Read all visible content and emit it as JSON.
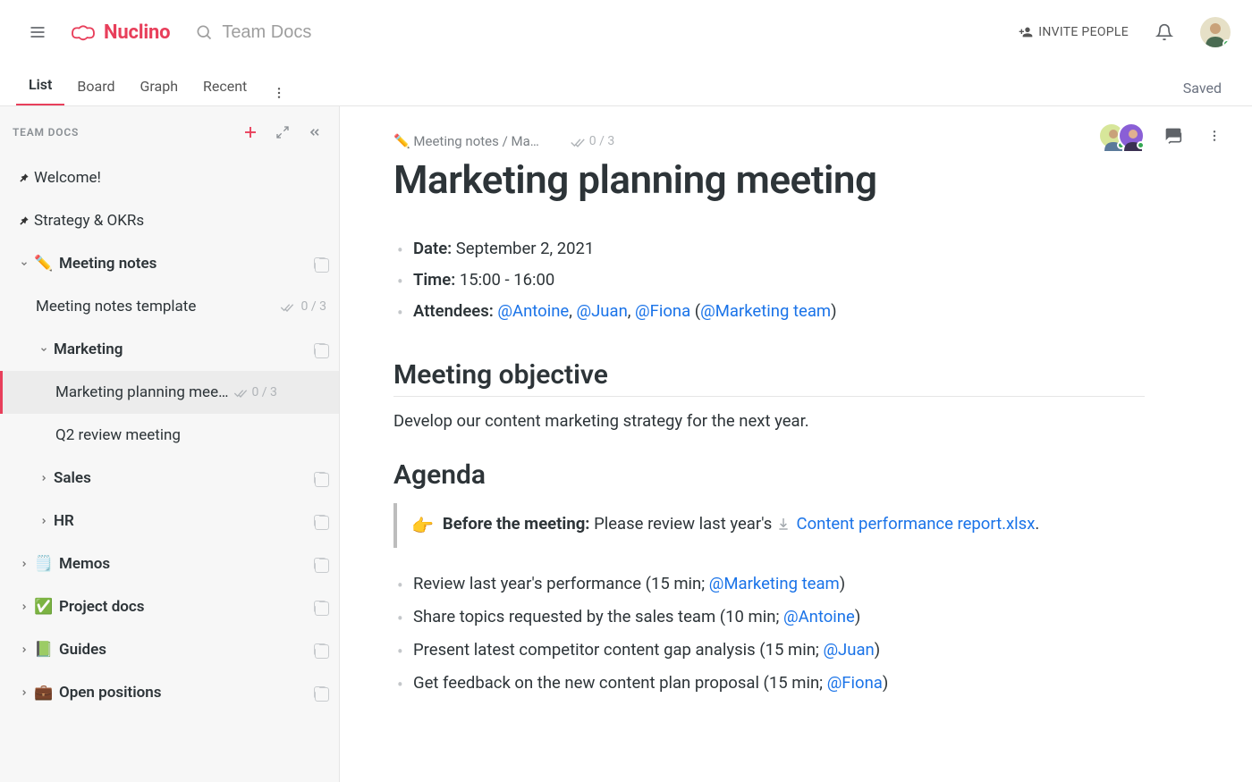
{
  "header": {
    "brand": "Nuclino",
    "search_placeholder": "Team Docs",
    "invite_label": "INVITE PEOPLE"
  },
  "tabs": {
    "items": [
      "List",
      "Board",
      "Graph",
      "Recent"
    ],
    "active_index": 0,
    "status": "Saved"
  },
  "sidebar": {
    "workspace_label": "TEAM DOCS",
    "pinned": [
      {
        "label": "Welcome!"
      },
      {
        "label": "Strategy & OKRs"
      }
    ],
    "tree": [
      {
        "icon": "✏️",
        "label": "Meeting notes",
        "bold": true,
        "expand": "open",
        "copy": true,
        "children": [
          {
            "label": "Meeting notes template",
            "check": "0 / 3"
          },
          {
            "label": "Marketing",
            "bold": true,
            "expand": "open",
            "copy": true,
            "children": [
              {
                "label": "Marketing planning mee…",
                "check": "0 / 3",
                "selected": true
              },
              {
                "label": "Q2 review meeting"
              }
            ]
          },
          {
            "label": "Sales",
            "bold": true,
            "expand": "closed",
            "copy": true
          },
          {
            "label": "HR",
            "bold": true,
            "expand": "closed",
            "copy": true
          }
        ]
      },
      {
        "icon": "🗒️",
        "label": "Memos",
        "bold": true,
        "expand": "closed",
        "copy": true
      },
      {
        "icon": "✅",
        "label": "Project docs",
        "bold": true,
        "expand": "closed",
        "copy": true
      },
      {
        "icon": "📗",
        "label": "Guides",
        "bold": true,
        "expand": "closed",
        "copy": true
      },
      {
        "icon": "💼",
        "label": "Open positions",
        "bold": true,
        "expand": "closed",
        "copy": true
      }
    ]
  },
  "doc": {
    "breadcrumb_icon": "✏️",
    "breadcrumb_text": "Meeting notes / Ma…",
    "breadcrumb_check": "0 / 3",
    "title": "Marketing planning meeting",
    "meta": {
      "date_label": "Date:",
      "date_value": " September 2, 2021",
      "time_label": "Time:",
      "time_value": " 15:00 - 16:00",
      "attendees_label": "Attendees: ",
      "attendees": [
        "@Antoine",
        "@Juan",
        "@Fiona"
      ],
      "attendees_group": "@Marketing team"
    },
    "objective": {
      "heading": "Meeting objective",
      "body": "Develop our content marketing strategy for the next year."
    },
    "agenda": {
      "heading": "Agenda",
      "callout_emoji": "👉",
      "callout_bold": "Before the meeting:",
      "callout_body": " Please review last year's ",
      "callout_attachment": "Content performance report.xlsx",
      "items": [
        {
          "text": "Review last year's performance (15 min; ",
          "mention": "@Marketing team",
          "after": ")"
        },
        {
          "text": "Share topics requested by the sales team (10 min; ",
          "mention": "@Antoine",
          "after": ")"
        },
        {
          "text": "Present latest competitor content gap analysis (15 min; ",
          "mention": "@Juan",
          "after": ")"
        },
        {
          "text": "Get feedback on the new content plan proposal (15 min; ",
          "mention": "@Fiona",
          "after": ")"
        }
      ]
    }
  }
}
